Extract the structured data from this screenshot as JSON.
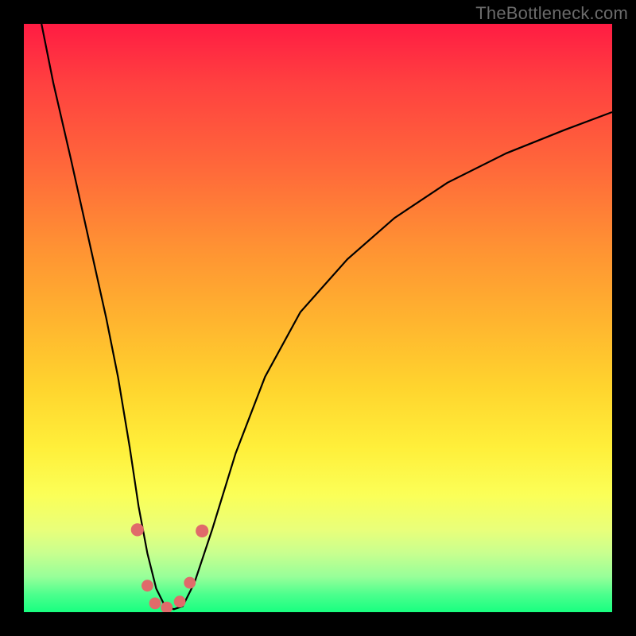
{
  "watermark": "TheBottleneck.com",
  "colors": {
    "frame": "#000000",
    "curve": "#000000",
    "marker": "#e06a6a",
    "gradient_top": "#ff1c43",
    "gradient_bottom": "#18ff80"
  },
  "chart_data": {
    "type": "line",
    "title": "",
    "xlabel": "",
    "ylabel": "",
    "xlim": [
      0,
      100
    ],
    "ylim": [
      0,
      100
    ],
    "grid": false,
    "legend": false,
    "annotations": [
      "TheBottleneck.com"
    ],
    "notes": "Axes unlabeled; x and y are normalized 0–100 to the plot area (left→right, bottom→top). Curve read off from pixel positions.",
    "series": [
      {
        "name": "curve",
        "x": [
          3,
          5,
          8,
          10,
          12,
          14,
          16,
          18,
          19.5,
          21,
          22.5,
          24,
          25.5,
          27,
          29,
          32,
          36,
          41,
          47,
          55,
          63,
          72,
          82,
          92,
          100
        ],
        "y": [
          100,
          90,
          77,
          68,
          59,
          50,
          40,
          28,
          18,
          10,
          4,
          1,
          0.5,
          1,
          5,
          14,
          27,
          40,
          51,
          60,
          67,
          73,
          78,
          82,
          85
        ]
      }
    ],
    "markers": [
      {
        "x": 19.3,
        "y": 14.0,
        "r": 1.1
      },
      {
        "x": 21.0,
        "y": 4.5,
        "r": 1.0
      },
      {
        "x": 22.3,
        "y": 1.5,
        "r": 1.0
      },
      {
        "x": 24.3,
        "y": 0.8,
        "r": 1.0
      },
      {
        "x": 26.5,
        "y": 1.8,
        "r": 1.0
      },
      {
        "x": 28.2,
        "y": 5.0,
        "r": 1.0
      },
      {
        "x": 30.3,
        "y": 13.8,
        "r": 1.1
      }
    ]
  }
}
